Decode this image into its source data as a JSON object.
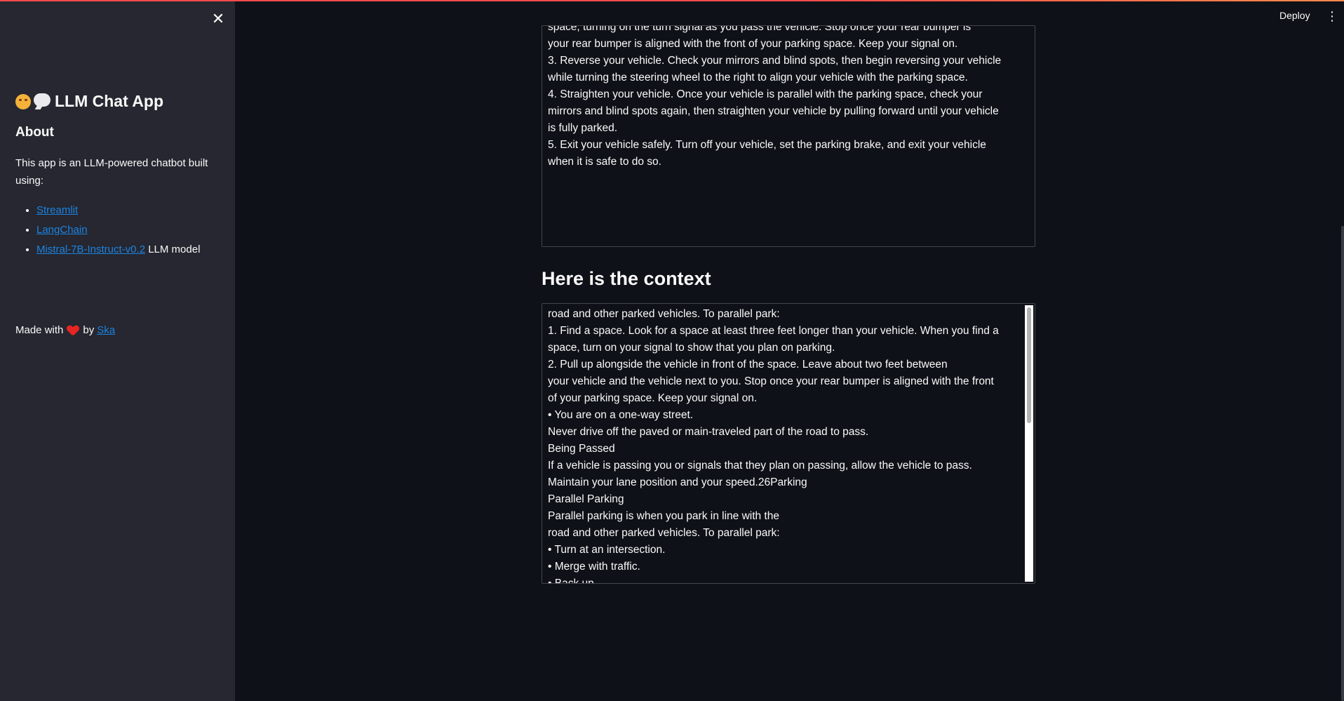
{
  "sidebar": {
    "close_icon": "close-icon",
    "title": "LLM Chat App",
    "title_icons": [
      "hugging-face-emoji",
      "speech-bubble-emoji"
    ],
    "about_heading": "About",
    "about_text": "This app is an LLM-powered chatbot built using:",
    "links": [
      {
        "text": "Streamlit",
        "suffix": ""
      },
      {
        "text": "LangChain",
        "suffix": ""
      },
      {
        "text": "Mistral-7B-Instruct-v0.2",
        "suffix": " LLM model"
      }
    ],
    "credit_prefix": "Made with",
    "credit_middle": "by",
    "credit_link": "Ska"
  },
  "header": {
    "deploy_label": "Deploy",
    "menu_icon": "kebab-menu-icon"
  },
  "main": {
    "answer_text": "space, turning on the turn signal as you pass the vehicle. Stop once your rear bumper is\nyour rear bumper is aligned with the front of your parking space. Keep your signal on.\n3. Reverse your vehicle. Check your mirrors and blind spots, then begin reversing your vehicle\nwhile turning the steering wheel to the right to align your vehicle with the parking space.\n4. Straighten your vehicle. Once your vehicle is parallel with the parking space, check your\nmirrors and blind spots again, then straighten your vehicle by pulling forward until your vehicle\nis fully parked.\n5. Exit your vehicle safely. Turn off your vehicle, set the parking brake, and exit your vehicle\nwhen it is safe to do so.",
    "context_heading": "Here is the context",
    "context_text": "road and other parked vehicles. To parallel park:\n1. Find a space. Look for a space at least three feet longer than your vehicle. When you find a\nspace, turn on your signal to show that you plan on parking.\n2. Pull up alongside the vehicle in front of the space. Leave about two feet between\nyour vehicle and the vehicle next to you. Stop once your rear bumper is aligned with the front\nof your parking space. Keep your signal on.\n• You are on a one-way street.\nNever drive off the paved or main-traveled part of the road to pass.\nBeing Passed\nIf a vehicle is passing you or signals that they plan on passing, allow the vehicle to pass.\nMaintain your lane position and your speed.26Parking\nParallel Parking\nParallel parking is when you park in line with the\nroad and other parked vehicles. To parallel park:\n• Turn at an intersection.\n• Merge with traffic.\n• Back up."
  },
  "colors": {
    "sidebar_bg": "#262730",
    "main_bg": "#0e1117",
    "link": "#1c83e1",
    "accent": "#ff4b4b"
  }
}
